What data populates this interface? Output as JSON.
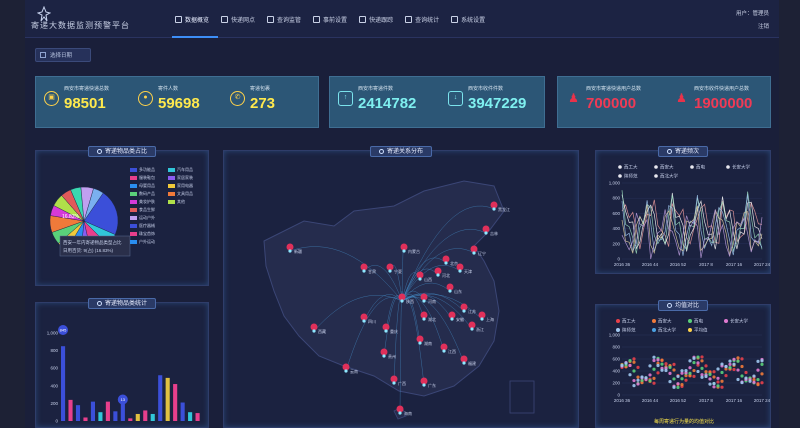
{
  "app": {
    "title": "寄递大数据监测预警平台"
  },
  "nav": [
    {
      "label": "数据概览",
      "icon": "grid-icon"
    },
    {
      "label": "快递网点",
      "icon": "cloud-icon"
    },
    {
      "label": "查询监管",
      "icon": "monitor-icon"
    },
    {
      "label": "事前设置",
      "icon": "settings-icon"
    },
    {
      "label": "快递跟踪",
      "icon": "location-icon"
    },
    {
      "label": "查询统计",
      "icon": "bar-chart-icon"
    },
    {
      "label": "系统设置",
      "icon": "gear-icon"
    }
  ],
  "user": {
    "greeting": "用户：管理员",
    "logout": "注销"
  },
  "date_button": "选择日期",
  "stats": [
    {
      "label": "西安市寄递快递总数",
      "value": "98501",
      "icon": "truck-icon",
      "color": "#ffe94d"
    },
    {
      "label": "寄件人数",
      "value": "59698",
      "icon": "user-icon",
      "color": "#ffe94d"
    },
    {
      "label": "寄递包裹",
      "value": "273",
      "icon": "phone-icon",
      "color": "#ffe94d"
    },
    {
      "label": "西安市寄递件数",
      "value": "2414782",
      "icon": "upload-icon",
      "color": "#7ff0f0"
    },
    {
      "label": "西安市收件件数",
      "value": "3947229",
      "icon": "download-icon",
      "color": "#7ff0f0"
    },
    {
      "label": "西安市寄递快递用户总数",
      "value": "700000",
      "icon": "people-icon",
      "color": "#f03a55"
    },
    {
      "label": "西安市收件快递用户总数",
      "value": "1900000",
      "icon": "people-icon",
      "color": "#f03a55"
    }
  ],
  "panels": {
    "pie": "寄递物品类占比",
    "map": "寄递关系分布",
    "freq": "寄递频次",
    "bar": "寄递物品类统计",
    "mean": "均值对比"
  },
  "pie": {
    "legend": [
      "多功能品",
      "汽车用品",
      "服装鞋包",
      "家居家装",
      "母婴用品",
      "家用电器",
      "数码产品",
      "文具用品",
      "美妆护肤",
      "其他",
      "食品生鲜",
      "",
      "运动户外",
      "",
      "医疗器械",
      "",
      "珠宝首饰",
      "",
      "户外运动",
      ""
    ],
    "colors": [
      "#3b4fd9",
      "#31c6d9",
      "#e83f8c",
      "#8a5cf0",
      "#2a8ef0",
      "#f0c93a",
      "#5ad07a",
      "#f07a3a",
      "#d63ad9",
      "#b0e04a",
      "#e05a5a",
      "#3ad9b0",
      "#c0a0f0",
      "#7ab0f0"
    ],
    "percent_label": "16.83%",
    "tooltip": "西安一年内寄递物品类型占比\n日用百货: 9(占) (16.83%)"
  },
  "bar_chart": {
    "y_ticks": [
      "1,000",
      "800",
      "600",
      "400",
      "200",
      "0"
    ],
    "y_max": 1000,
    "badge": "845",
    "badge2": "13",
    "values": [
      850,
      240,
      180,
      40,
      220,
      100,
      220,
      110,
      210,
      30,
      80,
      120,
      80,
      520,
      490,
      420,
      210,
      100,
      90
    ],
    "colors": [
      "#3b4fd9",
      "#e83f8c",
      "#3b4fd9",
      "#e83f8c",
      "#3b4fd9",
      "#31c6d9",
      "#e83f8c",
      "#3b4fd9",
      "#3b4fd9",
      "#e83f8c",
      "#e0c040",
      "#e83f8c",
      "#31c6d9",
      "#3b4fd9",
      "#e0c040",
      "#e83f8c",
      "#3b4fd9",
      "#31c6d9",
      "#e83f8c"
    ]
  },
  "freq_chart": {
    "legend": [
      "西工大",
      "西安大",
      "西电",
      "长安大学",
      "陕师范",
      "西北大学"
    ],
    "y_ticks": [
      "1,000",
      "800",
      "600",
      "400",
      "200",
      "0"
    ],
    "x_ticks": [
      "2016 36",
      "2016 44",
      "2016 52",
      "2017 8",
      "2017 16",
      "2017 24"
    ]
  },
  "mean_chart": {
    "legend": [
      "西工大",
      "西安大",
      "西电",
      "长安大学",
      "陕师范",
      "西北大学",
      "平均值"
    ],
    "y_ticks": [
      "1,000",
      "800",
      "600",
      "400",
      "200",
      "0"
    ],
    "x_ticks": [
      "2016 36",
      "2016 44",
      "2016 52",
      "2017 8",
      "2017 16",
      "2017 24"
    ],
    "footer": "每周寄递行为量的均值对比"
  },
  "map": {
    "cities": [
      "新疆",
      "黑龙江",
      "吉林",
      "辽宁",
      "北京",
      "天津",
      "河北",
      "山西",
      "陕西",
      "河南",
      "山东",
      "江苏",
      "上海",
      "浙江",
      "安徽",
      "湖北",
      "四川",
      "重庆",
      "湖南",
      "江西",
      "福建",
      "贵州",
      "云南",
      "广西",
      "广东",
      "海南",
      "西藏",
      "甘肃",
      "宁夏",
      "内蒙古"
    ]
  }
}
